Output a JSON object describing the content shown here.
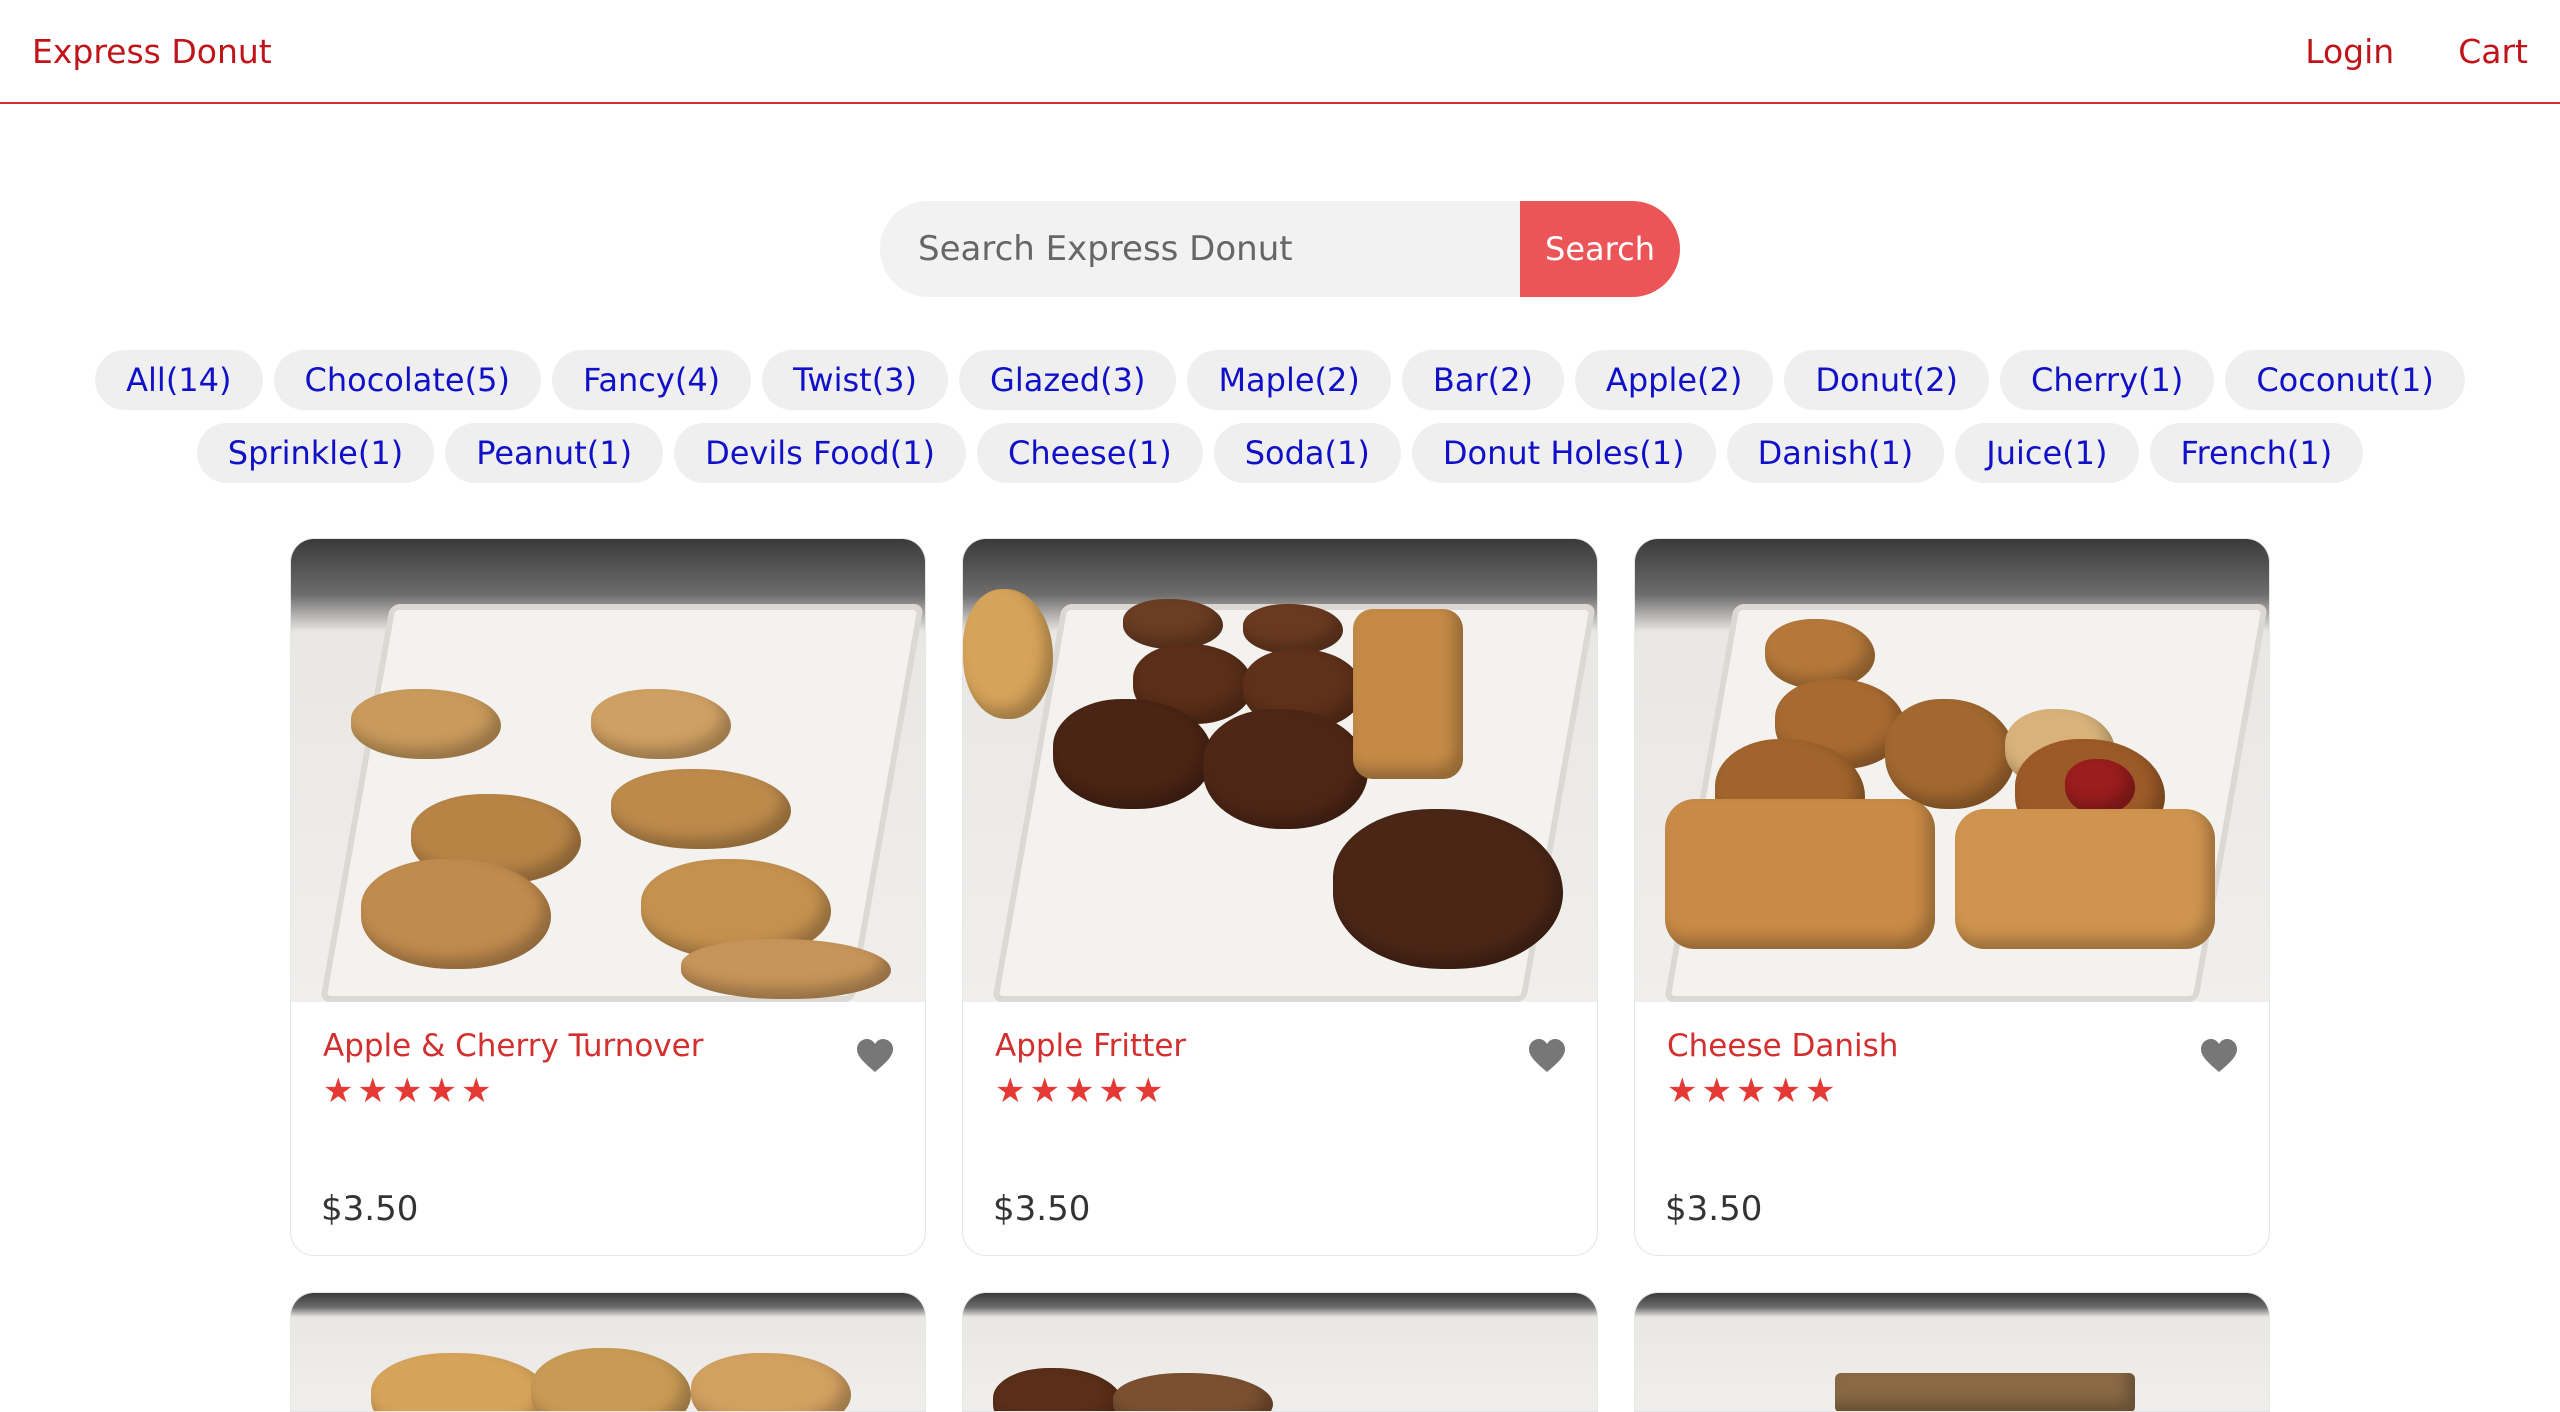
{
  "nav": {
    "brand": "Express Donut",
    "login": "Login",
    "cart": "Cart"
  },
  "search": {
    "placeholder": "Search Express Donut",
    "button": "Search"
  },
  "categories_row1": [
    "All(14)",
    "Chocolate(5)",
    "Fancy(4)",
    "Twist(3)",
    "Glazed(3)",
    "Maple(2)",
    "Bar(2)",
    "Apple(2)",
    "Donut(2)",
    "Cherry(1)",
    "Coconut(1)"
  ],
  "categories_row2": [
    "Sprinkle(1)",
    "Peanut(1)",
    "Devils Food(1)",
    "Cheese(1)",
    "Soda(1)",
    "Donut Holes(1)",
    "Danish(1)",
    "Juice(1)",
    "French(1)"
  ],
  "products": [
    {
      "name": "Apple & Cherry Turnover",
      "price": "$3.50",
      "rating": 5,
      "icon": "heart-icon"
    },
    {
      "name": "Apple Fritter",
      "price": "$3.50",
      "rating": 5,
      "icon": "heart-icon"
    },
    {
      "name": "Cheese Danish",
      "price": "$3.50",
      "rating": 5,
      "icon": "heart-icon"
    }
  ],
  "colors": {
    "accent": "#c0141a",
    "search_button": "#ec5558",
    "chip_text": "#1010c8",
    "star": "#e53935"
  }
}
